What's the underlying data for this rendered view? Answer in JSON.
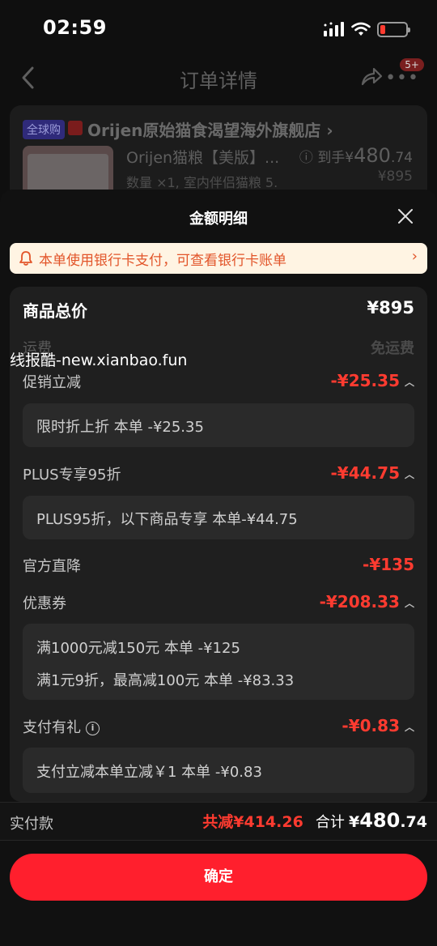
{
  "status_bar": {
    "time": "02:59"
  },
  "header": {
    "title": "订单详情",
    "more_badge": "5+"
  },
  "order": {
    "global_tag": "全球购",
    "shop_name": "Orijen原始猫食渴望海外旗舰店",
    "shop_chevron": "›",
    "product_name": "Orijen猫粮【美版】...",
    "product_spec": "数量 ×1, 室内伴侣猫粮 5.",
    "price_prefix": "到手¥",
    "price_main": "480",
    "price_decimal": ".74",
    "original_price": "¥895"
  },
  "sheet": {
    "title": "金额明细",
    "notice": "本单使用银行卡支付，可查看银行卡账单",
    "notice_chevron": "›"
  },
  "details": {
    "total": {
      "label": "商品总价",
      "value": "¥895"
    },
    "shipping": {
      "label": "运费",
      "value": "免运费"
    },
    "promo": {
      "label": "促销立减",
      "value": "-¥25.35",
      "lines": [
        "限时折上折   本单 -¥25.35"
      ]
    },
    "plus": {
      "label": "PLUS专享95折",
      "value": "-¥44.75",
      "lines": [
        "PLUS95折，以下商品专享   本单-¥44.75"
      ]
    },
    "official": {
      "label": "官方直降",
      "value": "-¥135"
    },
    "coupon": {
      "label": "优惠券",
      "value": "-¥208.33",
      "lines": [
        "满1000元减150元   本单 -¥125",
        "满1元9折，最高减100元   本单 -¥83.33"
      ]
    },
    "pay_gift": {
      "label": "支付有礼",
      "value": "-¥0.83",
      "lines": [
        "支付立减本单立减￥1   本单 -¥0.83"
      ]
    }
  },
  "watermark": "线报酷-new.xianbao.fun",
  "bottom": {
    "label": "实付款",
    "reduce": "共减¥414.26",
    "total_label": "合计",
    "total_prefix": "¥",
    "total_main": "480",
    "total_decimal": ".74"
  },
  "confirm_label": "确定",
  "colors": {
    "accent": "#ff1f2d",
    "discount": "#ff3b30",
    "notice_bg": "#fff4e3",
    "notice_text": "#e2552a"
  }
}
